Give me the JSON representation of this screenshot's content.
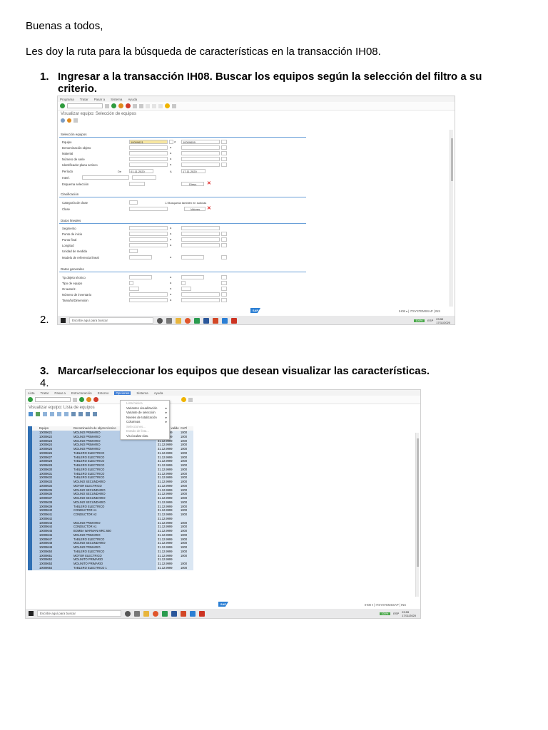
{
  "doc": {
    "greeting": "Buenas a todos,",
    "intro": "Les doy la ruta para la búsqueda de características en la transacción IH08.",
    "steps": [
      {
        "num": "1.",
        "text": "Ingresar a la transacción IH08. Buscar los equipos según la selección del filtro a su criterio."
      },
      {
        "num": "2.",
        "text": ""
      },
      {
        "num": "3.",
        "text": "Marcar/seleccionar los equipos que desean visualizar las características."
      },
      {
        "num": "4.",
        "text": ""
      }
    ]
  },
  "shot1": {
    "menu": [
      "Programa",
      "Tratar",
      "Pasar a",
      "Sistema",
      "Ayuda"
    ],
    "title": "Visualizar equipo: Selección de equipos",
    "sections": {
      "seleccion": "Selección equipos",
      "clasificacion": "Clasificación",
      "lineales": "Datos lineales",
      "generales": "Datos generales"
    },
    "fields_seleccion": [
      "Equipo",
      "Denominación objeto",
      "Material",
      "Número de serie",
      "Identificador placa serisco",
      "Período",
      "Interl.",
      "Esquema selección"
    ],
    "fields_clasif": [
      "Categoría de clase",
      "Clase"
    ],
    "fields_lineales": [
      "Segmento",
      "Punto de inicio",
      "Punto final",
      "Longitud",
      "Unidad de medida",
      "Modelo de referencia lineal"
    ],
    "fields_generales": [
      "Tp.objeto técnico",
      "Tipo de equipo",
      "Gr.autoriz.",
      "Número de inventario",
      "Tamaño/Dimensión"
    ],
    "equipo_from": "10009621",
    "equipo_to": "10009659",
    "periodo_de_label": "De",
    "periodo_from": "01.11.2020",
    "periodo_a_label": "A",
    "periodo_to": "17.11.2020",
    "a_label": "a",
    "btn_dinsc": "Dinsc.",
    "btn_valores": "Valores",
    "busqueda_label": "Búsqueda también en subclas",
    "status": "IH08 ▾ | ITSYSTEMSSAP | INS",
    "sap": "SAP"
  },
  "shot2": {
    "menu": [
      "Lista",
      "Tratar",
      "Pasar a",
      "Estructuración",
      "Entorno",
      "Opciones",
      "Sistema",
      "Ayuda"
    ],
    "active_menu": "Opciones",
    "title": "Visualizar equipo: Lista de equipos",
    "col_equipo": "Equipo",
    "col_denom": "Denominación de objeto técnico",
    "col_valido": "Válido de validez",
    "col_ce": "CePl",
    "dropdown": [
      {
        "label": "Lista básica",
        "disabled": true,
        "arrow": ""
      },
      {
        "label": "Variantes visualización",
        "disabled": false,
        "arrow": "▸"
      },
      {
        "label": "Variante de selección",
        "disabled": false,
        "arrow": "▸"
      },
      {
        "label": "Niveles de totalización",
        "disabled": false,
        "arrow": "▸"
      },
      {
        "label": "Columnas",
        "disabled": false,
        "arrow": "▸"
      },
      {
        "label": "Selecciones...",
        "disabled": true,
        "arrow": ""
      },
      {
        "label": "Estado de lista...",
        "disabled": true,
        "arrow": ""
      },
      {
        "label": "Vis./ocultar clas.",
        "disabled": false,
        "arrow": ""
      }
    ],
    "rows": [
      [
        "10009621",
        "MOLINO PRIMARIO",
        "31.12.9999",
        "1000"
      ],
      [
        "10009622",
        "MOLINO PRIMARIO",
        "31.12.9999",
        "1000"
      ],
      [
        "10009623",
        "MOLINO PRIMARIO",
        "31.12.9999",
        "1000"
      ],
      [
        "10009624",
        "MOLINO PRIMARIO",
        "31.12.9999",
        "1000"
      ],
      [
        "10009625",
        "MOLINO PRIMARIO",
        "31.12.9999",
        "1000"
      ],
      [
        "10009626",
        "TABLERO ELECTRICO",
        "31.12.9999",
        "1000"
      ],
      [
        "10009627",
        "TABLERO ELECTRICO",
        "31.12.9999",
        "1000"
      ],
      [
        "10009628",
        "TABLERO ELECTRICO",
        "31.12.9999",
        "1000"
      ],
      [
        "10009629",
        "TABLERO ELECTRICO",
        "31.12.9999",
        "1000"
      ],
      [
        "10009630",
        "TABLERO ELECTRICO",
        "31.12.9999",
        "1000"
      ],
      [
        "10009631",
        "TABLERO ELECTRICO",
        "31.12.9999",
        "1000"
      ],
      [
        "10009632",
        "TABLERO ELECTRICO",
        "31.12.9999",
        "1000"
      ],
      [
        "10009633",
        "MOLINO SECUNDARIO",
        "31.12.9999",
        "1000"
      ],
      [
        "10009634",
        "MOTOR ELECTRICO",
        "31.12.9999",
        "1000"
      ],
      [
        "10009635",
        "MOLINO SECUNDARIO",
        "31.12.9999",
        "1000"
      ],
      [
        "10009636",
        "MOLINO SECUNDARIO",
        "31.12.9999",
        "1000"
      ],
      [
        "10009637",
        "MOLINO SECUNDARIO",
        "31.12.9999",
        "1000"
      ],
      [
        "10009638",
        "MOLINO SECUNDARIO",
        "31.12.9999",
        "1000"
      ],
      [
        "10009639",
        "TABLERO ELECTRICO",
        "31.12.9999",
        "1000"
      ],
      [
        "10009640",
        "CONDUCTOR A1",
        "31.12.9999",
        "1000"
      ],
      [
        "10009641",
        "CONDUCTOR A2",
        "31.12.9999",
        "1000"
      ],
      [
        "10009642",
        "",
        "31.12.9999",
        ""
      ],
      [
        "10009643",
        "MOLINO PRIMARIO",
        "31.12.9999",
        "1000"
      ],
      [
        "10009644",
        "CONDUCTOR A1",
        "31.12.9999",
        "1000"
      ],
      [
        "10009645",
        "BOMBA WARMAN MRC 650",
        "31.12.9999",
        "1000"
      ],
      [
        "10009646",
        "MOLINO PRIMARIO",
        "31.12.9999",
        "1000"
      ],
      [
        "10009647",
        "TABLERO ELECTRICO",
        "31.12.9999",
        "1000"
      ],
      [
        "10009648",
        "MOLINO SECUNDARIO",
        "31.12.9999",
        "1000"
      ],
      [
        "10009649",
        "MOLINO PRIMARIO",
        "31.12.9999",
        "1000"
      ],
      [
        "10009650",
        "TABLERO ELECTRICO",
        "31.12.9999",
        "1000"
      ],
      [
        "10009651",
        "MOTOR ELECTRICO",
        "31.12.9999",
        "1000"
      ],
      [
        "10009652",
        "MOLINITO PRIMARIO",
        "31.12.9999",
        ""
      ],
      [
        "10009653",
        "MOLINITO PRIMARIO",
        "31.12.9999",
        "1000"
      ],
      [
        "10009654",
        "TABLERO ELECTRICO 1",
        "31.12.9999",
        "1000"
      ]
    ],
    "status": "IH08 ▾ | ITSYSTEMSSAP | INS",
    "sap": "SAP"
  },
  "taskbar": {
    "search_placeholder": "Escribe aquí para buscar",
    "battery": "100%",
    "time": "23:59",
    "date": "17/11/2020",
    "lang": "ESP"
  }
}
